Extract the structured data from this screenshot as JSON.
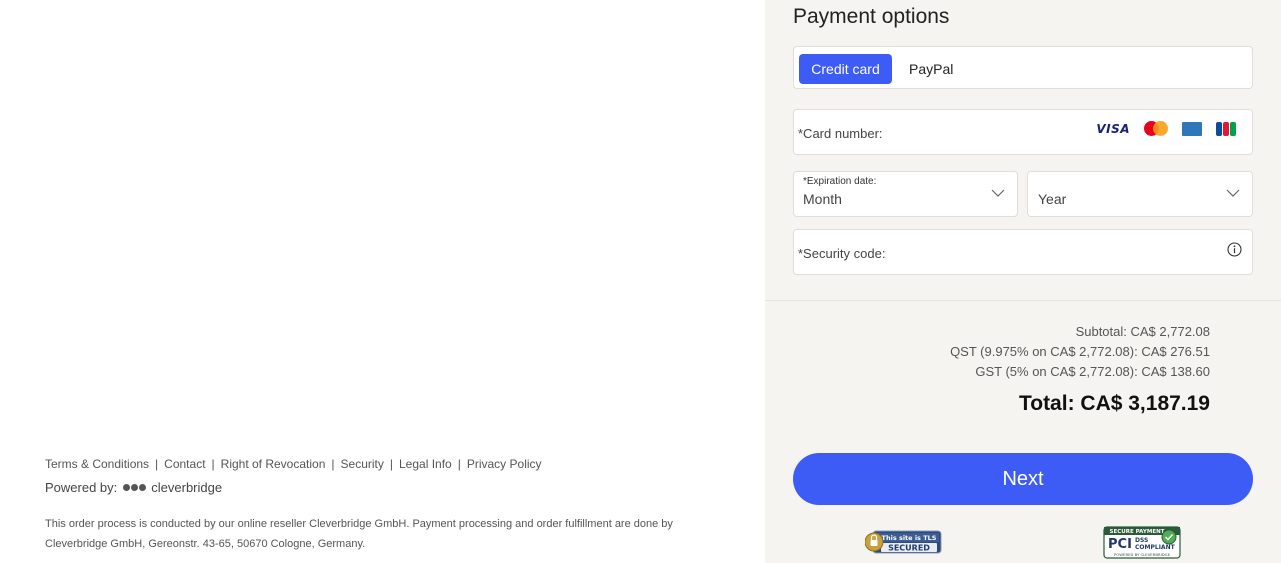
{
  "footer": {
    "links": [
      "Terms & Conditions",
      "Contact",
      "Right of Revocation",
      "Security",
      "Legal Info",
      "Privacy Policy"
    ],
    "separator": "|",
    "powered_label": "Powered by:",
    "powered_brand": "cleverbridge",
    "legal_text": "This order process is conducted by our online reseller Cleverbridge GmbH. Payment processing and order fulfillment are done by Cleverbridge GmbH, Gereonstr. 43-65, 50670 Cologne, Germany."
  },
  "payment": {
    "title": "Payment options",
    "tabs": [
      {
        "label": "Credit card",
        "active": true
      },
      {
        "label": "PayPal",
        "active": false
      }
    ],
    "card_number_placeholder": "*Card number:",
    "card_brands": [
      "visa-icon",
      "mastercard-icon",
      "amex-icon",
      "jcb-icon"
    ],
    "visa_label": "VISA",
    "expiration_label": "*Expiration date:",
    "month_value": "Month",
    "year_value": "Year",
    "security_code_placeholder": "*Security code:"
  },
  "summary": {
    "subtotal": "Subtotal: CA$ 2,772.08",
    "qst": "QST (9.975% on CA$ 2,772.08): CA$ 276.51",
    "gst": "GST (5% on CA$ 2,772.08): CA$ 138.60",
    "total": "Total: CA$ 3,187.19"
  },
  "actions": {
    "next_label": "Next"
  },
  "badges": {
    "tls_line1": "This site is TLS",
    "tls_line2": "SECURED",
    "pci_top": "SECURE PAYMENT",
    "pci_main": "PCI",
    "pci_sub1": "DSS",
    "pci_sub2": "COMPLIANT",
    "pci_bottom": "POWERED BY CLEVERBRIDGE"
  },
  "colors": {
    "accent": "#3d5cf5",
    "panel_bg": "#f6f4f1",
    "border": "#e1ddd8"
  }
}
